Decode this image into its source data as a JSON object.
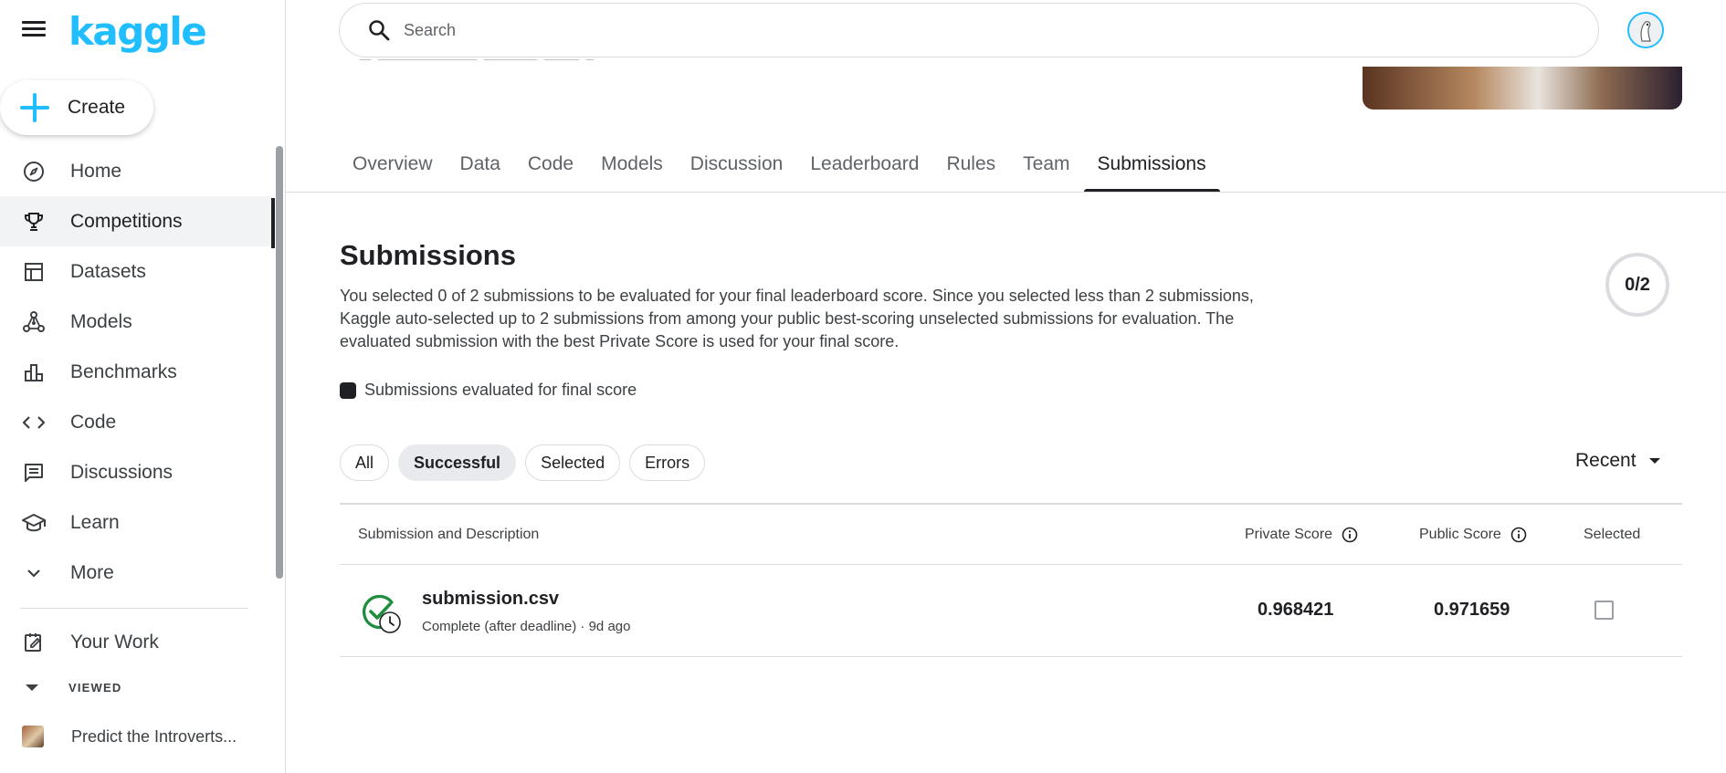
{
  "sidebar": {
    "logo": "kaggle",
    "create_label": "Create",
    "items": [
      {
        "label": "Home",
        "icon": "compass-icon"
      },
      {
        "label": "Competitions",
        "icon": "trophy-icon"
      },
      {
        "label": "Datasets",
        "icon": "table-icon"
      },
      {
        "label": "Models",
        "icon": "models-icon"
      },
      {
        "label": "Benchmarks",
        "icon": "bar-chart-icon"
      },
      {
        "label": "Code",
        "icon": "code-icon"
      },
      {
        "label": "Discussions",
        "icon": "comment-icon"
      },
      {
        "label": "Learn",
        "icon": "graduation-cap-icon"
      },
      {
        "label": "More",
        "icon": "chevron-down-icon"
      }
    ],
    "active_item": "Competitions",
    "your_work": "Your Work",
    "viewed_label": "VIEWED",
    "recent_item": "Predict the Introverts..."
  },
  "search": {
    "placeholder": "Search"
  },
  "tabs": [
    "Overview",
    "Data",
    "Code",
    "Models",
    "Discussion",
    "Leaderboard",
    "Rules",
    "Team",
    "Submissions"
  ],
  "active_tab": "Submissions",
  "submissions": {
    "title": "Submissions",
    "description": "You selected 0 of 2 submissions to be evaluated for your final leaderboard score. Since you selected less than 2 submissions, Kaggle auto-selected up to 2 submissions from among your public best-scoring unselected submissions for evaluation. The evaluated submission with the best Private Score is used for your final score.",
    "counter": "0/2",
    "legend": "Submissions evaluated for final score",
    "filters": [
      "All",
      "Successful",
      "Selected",
      "Errors"
    ],
    "active_filter": "Successful",
    "sort_label": "Recent"
  },
  "table": {
    "headers": {
      "submission": "Submission and Description",
      "private": "Private Score",
      "public": "Public Score",
      "selected": "Selected"
    },
    "rows": [
      {
        "file": "submission.csv",
        "meta": "Complete (after deadline) · 9d ago",
        "private_score": "0.968421",
        "public_score": "0.971659",
        "selected": false
      }
    ]
  },
  "colors": {
    "brand": "#20beff",
    "success": "#1e8e3e",
    "text": "#202124"
  }
}
